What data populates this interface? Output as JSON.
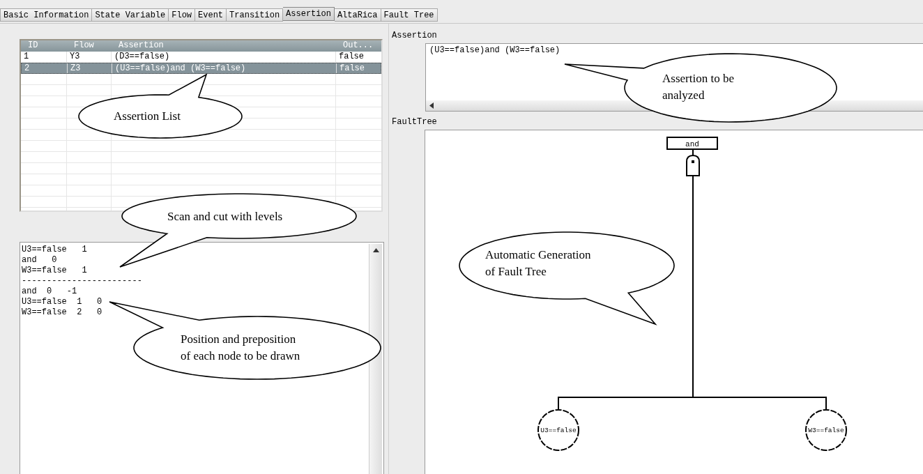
{
  "tabs": [
    {
      "label": "Basic Information",
      "selected": false
    },
    {
      "label": "State Variable",
      "selected": false
    },
    {
      "label": "Flow",
      "selected": false
    },
    {
      "label": "Event",
      "selected": false
    },
    {
      "label": "Transition",
      "selected": false
    },
    {
      "label": "Assertion",
      "selected": true
    },
    {
      "label": "AltaRica",
      "selected": false
    },
    {
      "label": "Fault Tree",
      "selected": false
    }
  ],
  "assertion_table": {
    "columns": [
      "ID",
      "Flow",
      "Assertion",
      "Out..."
    ],
    "rows": [
      {
        "cells": [
          "1",
          "Y3",
          "(D3==false)",
          "false"
        ],
        "selected": false
      },
      {
        "cells": [
          "2",
          "Z3",
          "(U3==false)and (W3==false)",
          "false"
        ],
        "selected": true
      }
    ]
  },
  "console": {
    "lines": [
      "U3==false   1",
      "and   0",
      "W3==false   1",
      "------------------------",
      "and  0   -1",
      "U3==false  1   0",
      "W3==false  2   0"
    ]
  },
  "assertion_field": {
    "label": "Assertion",
    "value": "(U3==false)and (W3==false)"
  },
  "fault_tree": {
    "label": "FaultTree",
    "root": {
      "label": "and",
      "kind": "and_gate",
      "children": [
        {
          "label": "U3==false",
          "kind": "basic"
        },
        {
          "label": "W3==false",
          "kind": "basic"
        }
      ]
    }
  },
  "callouts": [
    {
      "text": "Assertion List"
    },
    {
      "text": "Scan and cut with levels"
    },
    {
      "text": "Position and preposition\nof each node to be drawn"
    },
    {
      "text": "Assertion to be\nanalyzed"
    },
    {
      "text": "Automatic Generation\nof Fault Tree"
    }
  ]
}
